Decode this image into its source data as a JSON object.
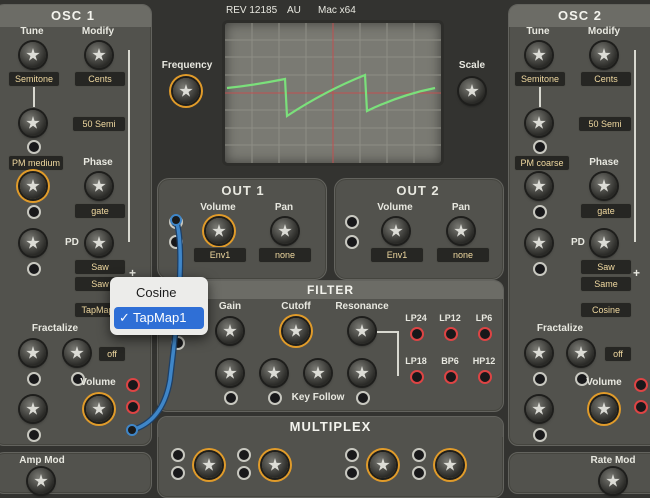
{
  "header": {
    "rev": "REV 12185",
    "format": "AU",
    "platform": "Mac x64"
  },
  "osc1": {
    "title": "OSC 1",
    "tune_label": "Tune",
    "modify_label": "Modify",
    "tune_value": "Semitone",
    "modify_value": "Cents",
    "semi_value": "50 Semi",
    "pm_value": "PM medium",
    "phase_label": "Phase",
    "phase_value": "gate",
    "pd_label": "PD",
    "pd_value1": "Saw",
    "pd_value2": "Saw",
    "pd_value3": "TapMap1",
    "fractalize_label": "Fractalize",
    "fractalize_value": "off",
    "volume_label": "Volume"
  },
  "osc2": {
    "title": "OSC 2",
    "tune_label": "Tune",
    "modify_label": "Modify",
    "tune_value": "Semitone",
    "modify_value": "Cents",
    "semi_value": "50 Semi",
    "pm_value": "PM coarse",
    "phase_label": "Phase",
    "phase_value": "gate",
    "pd_label": "PD",
    "pd_value1": "Saw",
    "pd_value2": "Same",
    "pd_value3": "Cosine",
    "fractalize_label": "Fractalize",
    "fractalize_value": "off",
    "volume_label": "Volume"
  },
  "scope": {
    "frequency_label": "Frequency",
    "scale_label": "Scale"
  },
  "out1": {
    "title": "OUT 1",
    "volume_label": "Volume",
    "pan_label": "Pan",
    "volume_value": "Env1",
    "pan_value": "none"
  },
  "out2": {
    "title": "OUT 2",
    "volume_label": "Volume",
    "pan_label": "Pan",
    "volume_value": "Env1",
    "pan_value": "none"
  },
  "filter": {
    "title": "FILTER",
    "gain_label": "Gain",
    "cutoff_label": "Cutoff",
    "resonance_label": "Resonance",
    "key_follow_label": "Key Follow",
    "modes": [
      "LP24",
      "LP12",
      "LP6",
      "LP18",
      "BP6",
      "HP12"
    ]
  },
  "multiplex": {
    "title": "MULTIPLEX"
  },
  "amp_mod": {
    "label": "Amp Mod"
  },
  "rate_mod": {
    "label": "Rate Mod"
  },
  "dropdown": {
    "items": [
      "Cosine",
      "TapMap1"
    ],
    "checked_mark": "✓",
    "selected": "TapMap1"
  },
  "colors": {
    "accent_orange": "#e09b2a",
    "scope_wave": "#7be07b",
    "cable_blue": "#3f86c8",
    "selection_blue": "#2f6fd6"
  }
}
